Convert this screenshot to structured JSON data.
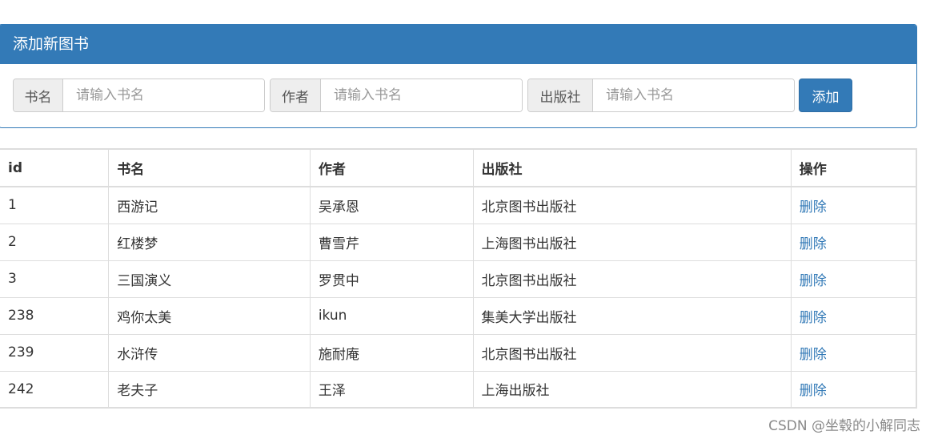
{
  "panel": {
    "title": "添加新图书"
  },
  "form": {
    "fields": [
      {
        "label": "书名",
        "placeholder": "请输入书名"
      },
      {
        "label": "作者",
        "placeholder": "请输入书名"
      },
      {
        "label": "出版社",
        "placeholder": "请输入书名"
      }
    ],
    "add_label": "添加"
  },
  "table": {
    "headers": [
      "id",
      "书名",
      "作者",
      "出版社",
      "操作"
    ],
    "rows": [
      {
        "id": "1",
        "name": "西游记",
        "author": "吴承恩",
        "press": "北京图书出版社",
        "action": "删除"
      },
      {
        "id": "2",
        "name": "红楼梦",
        "author": "曹雪芹",
        "press": "上海图书出版社",
        "action": "删除"
      },
      {
        "id": "3",
        "name": "三国演义",
        "author": "罗贯中",
        "press": "北京图书出版社",
        "action": "删除"
      },
      {
        "id": "238",
        "name": "鸡你太美",
        "author": "ikun",
        "press": "集美大学出版社",
        "action": "删除"
      },
      {
        "id": "239",
        "name": "水浒传",
        "author": "施耐庵",
        "press": "北京图书出版社",
        "action": "删除"
      },
      {
        "id": "242",
        "name": "老夫子",
        "author": "王泽",
        "press": "上海出版社",
        "action": "删除"
      }
    ]
  },
  "watermark": "CSDN @坐毂的小解同志",
  "colors": {
    "primary": "#337ab7",
    "border": "#dddddd",
    "addon_bg": "#eeeeee"
  }
}
